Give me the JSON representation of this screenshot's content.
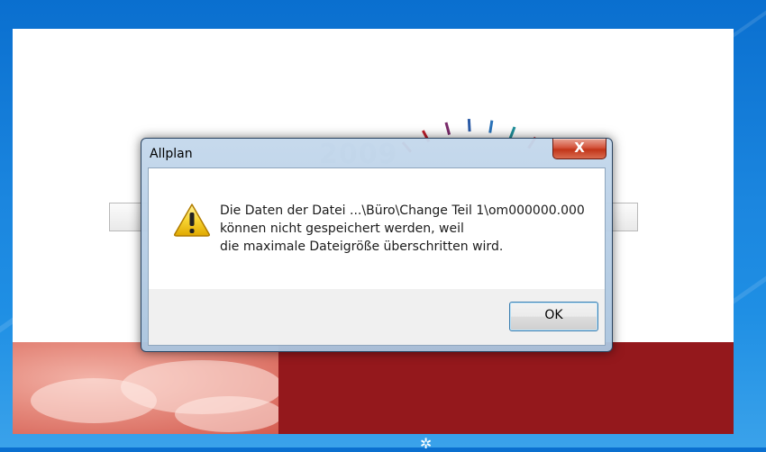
{
  "dialog": {
    "title": "Allplan",
    "close_label": "X",
    "message_lines": [
      "Die Daten der Datei  ...\\Büro\\Change Teil 1\\om000000.000",
      "können nicht gespeichert werden, weil",
      "die maximale Dateigröße überschritten wird."
    ],
    "ok_label": "OK",
    "icon": "warning-icon"
  },
  "splash": {
    "year": "2009",
    "colors": {
      "band_dark_red": "#94181c",
      "band_pink": "#e58a7d"
    }
  },
  "desktop": {
    "icon": "flower-icon"
  }
}
